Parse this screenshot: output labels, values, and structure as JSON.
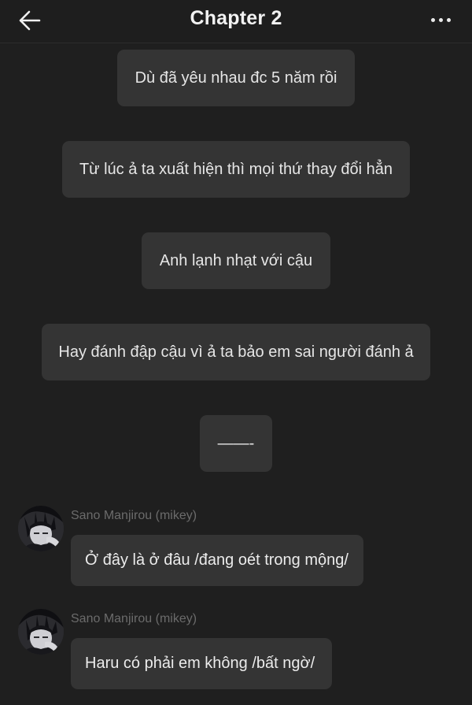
{
  "header": {
    "title": "Chapter 2",
    "back_icon": "arrow-left-icon",
    "more_icon": "more-dots-icon"
  },
  "narration": [
    "Dù đã yêu nhau đc 5 năm rồi",
    "Từ lúc ả ta xuất hiện thì mọi thứ thay đổi hẳn",
    "Anh lạnh nhạt với cậu",
    "Hay đánh đập cậu vì ả ta bảo em sai người đánh ả",
    "——-"
  ],
  "messages": [
    {
      "speaker": "Sano Manjirou (mikey)",
      "text": "Ở đây là ở đâu /đang oét trong mộng/"
    },
    {
      "speaker": "Sano Manjirou (mikey)",
      "text": "Haru có phải em không /bất ngờ/"
    }
  ],
  "colors": {
    "background": "#1f1f1f",
    "bubble": "#343434",
    "speaker_text": "#6b6b6b"
  }
}
